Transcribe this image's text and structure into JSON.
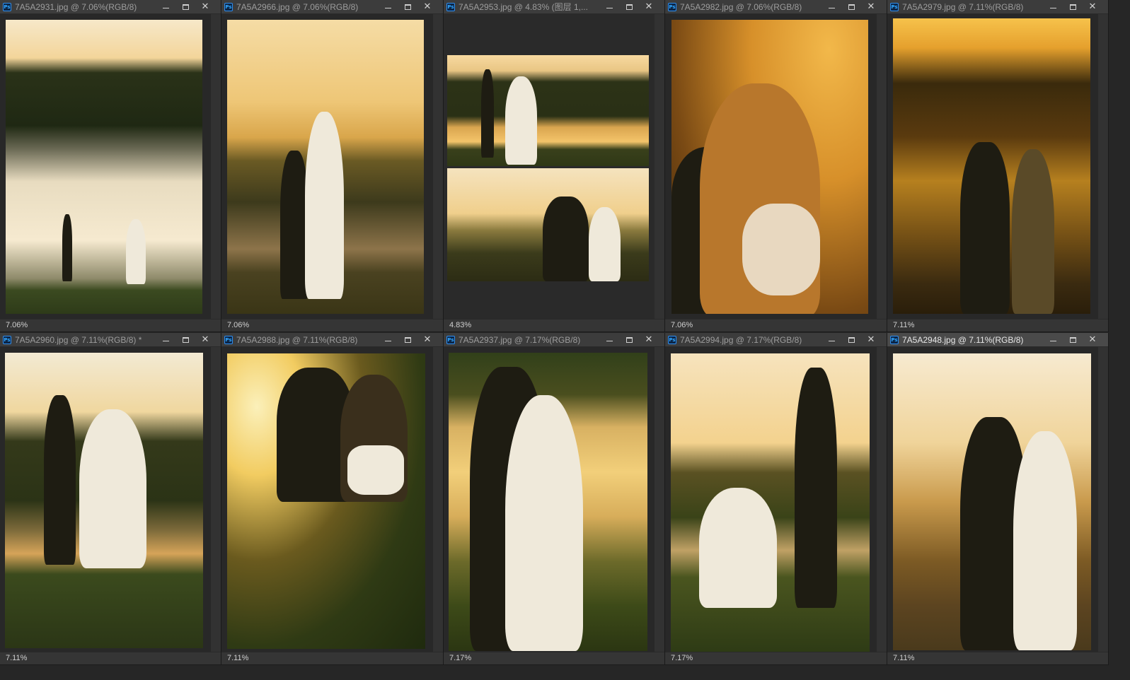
{
  "app": "Photoshop document windows",
  "windows": [
    {
      "title": "7A5A2931.jpg @ 7.06%(RGB/8)",
      "zoom": "7.06%",
      "active": false
    },
    {
      "title": "7A5A2966.jpg @ 7.06%(RGB/8)",
      "zoom": "7.06%",
      "active": false
    },
    {
      "title": "7A5A2953.jpg @ 4.83% (图层 1,...",
      "zoom": "4.83%",
      "active": false
    },
    {
      "title": "7A5A2982.jpg @ 7.06%(RGB/8)",
      "zoom": "7.06%",
      "active": false
    },
    {
      "title": "7A5A2979.jpg @ 7.11%(RGB/8)",
      "zoom": "7.11%",
      "active": false
    },
    {
      "title": "7A5A2960.jpg @ 7.11%(RGB/8) *",
      "zoom": "7.11%",
      "active": false
    },
    {
      "title": "7A5A2988.jpg @ 7.11%(RGB/8)",
      "zoom": "7.11%",
      "active": false
    },
    {
      "title": "7A5A2937.jpg @ 7.17%(RGB/8)",
      "zoom": "7.17%",
      "active": false
    },
    {
      "title": "7A5A2994.jpg @ 7.17%(RGB/8)",
      "zoom": "7.17%",
      "active": false
    },
    {
      "title": "7A5A2948.jpg @ 7.11%(RGB/8)",
      "zoom": "7.11%",
      "active": true
    }
  ],
  "icons": {
    "app": "ps-icon",
    "minimize": "minimize-icon",
    "maximize": "maximize-icon",
    "close": "close-icon"
  },
  "icon_glyphs": {
    "ps": "Ps",
    "close": "✕"
  }
}
